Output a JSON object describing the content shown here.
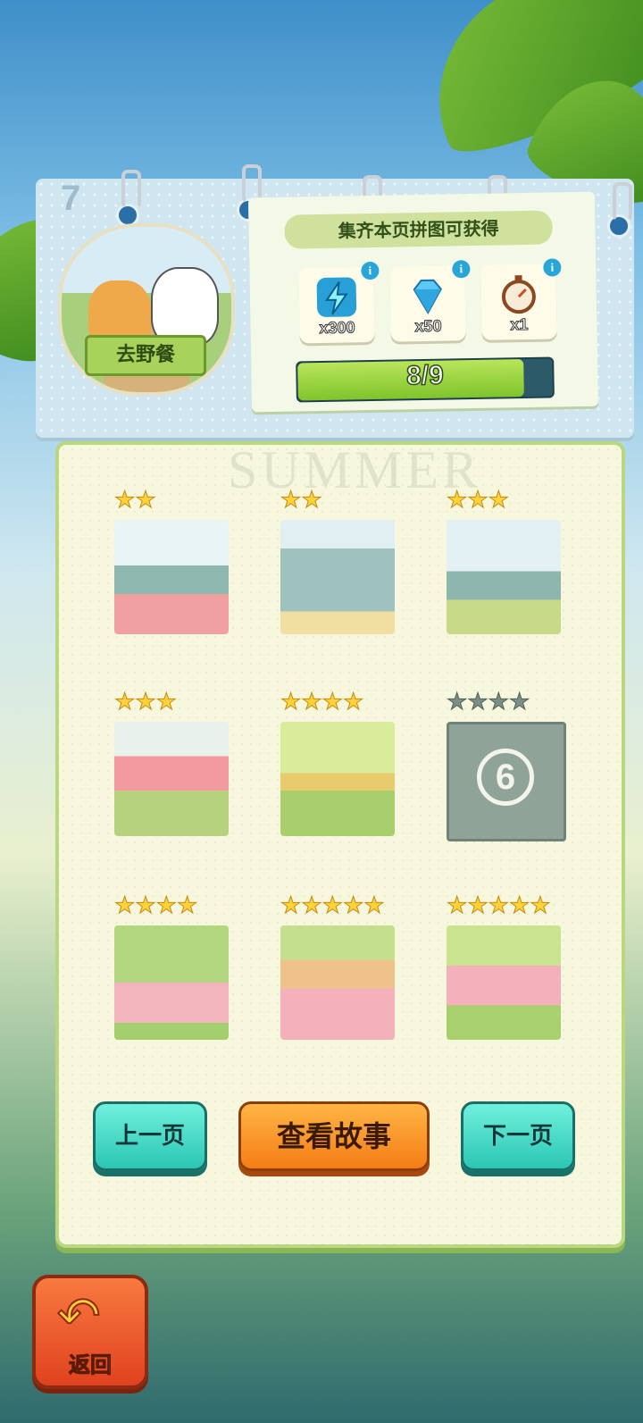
{
  "page": {
    "number": "7"
  },
  "chapter": {
    "title": "去野餐"
  },
  "rewards": {
    "title": "集齐本页拼图可获得",
    "items": [
      {
        "icon": "energy-bolt-icon",
        "count": "x300"
      },
      {
        "icon": "diamond-icon",
        "count": "x50"
      },
      {
        "icon": "stopwatch-icon",
        "count": "x1"
      }
    ],
    "progress_text": "8/9",
    "progress_fraction": 0.889
  },
  "watermark": "SUMMER",
  "pieces": [
    {
      "stars": 2,
      "max": 2,
      "unlocked": true
    },
    {
      "stars": 2,
      "max": 2,
      "unlocked": true
    },
    {
      "stars": 3,
      "max": 3,
      "unlocked": true
    },
    {
      "stars": 3,
      "max": 3,
      "unlocked": true
    },
    {
      "stars": 4,
      "max": 4,
      "unlocked": true
    },
    {
      "stars": 0,
      "max": 4,
      "unlocked": false,
      "label": "6"
    },
    {
      "stars": 4,
      "max": 4,
      "unlocked": true
    },
    {
      "stars": 5,
      "max": 5,
      "unlocked": true
    },
    {
      "stars": 5,
      "max": 5,
      "unlocked": true
    }
  ],
  "buttons": {
    "prev": "上一页",
    "story": "查看故事",
    "next": "下一页",
    "back": "返回"
  },
  "colors": {
    "accent_teal": "#2bc6b4",
    "accent_orange": "#f47d16",
    "progress_green": "#7fc42c"
  }
}
